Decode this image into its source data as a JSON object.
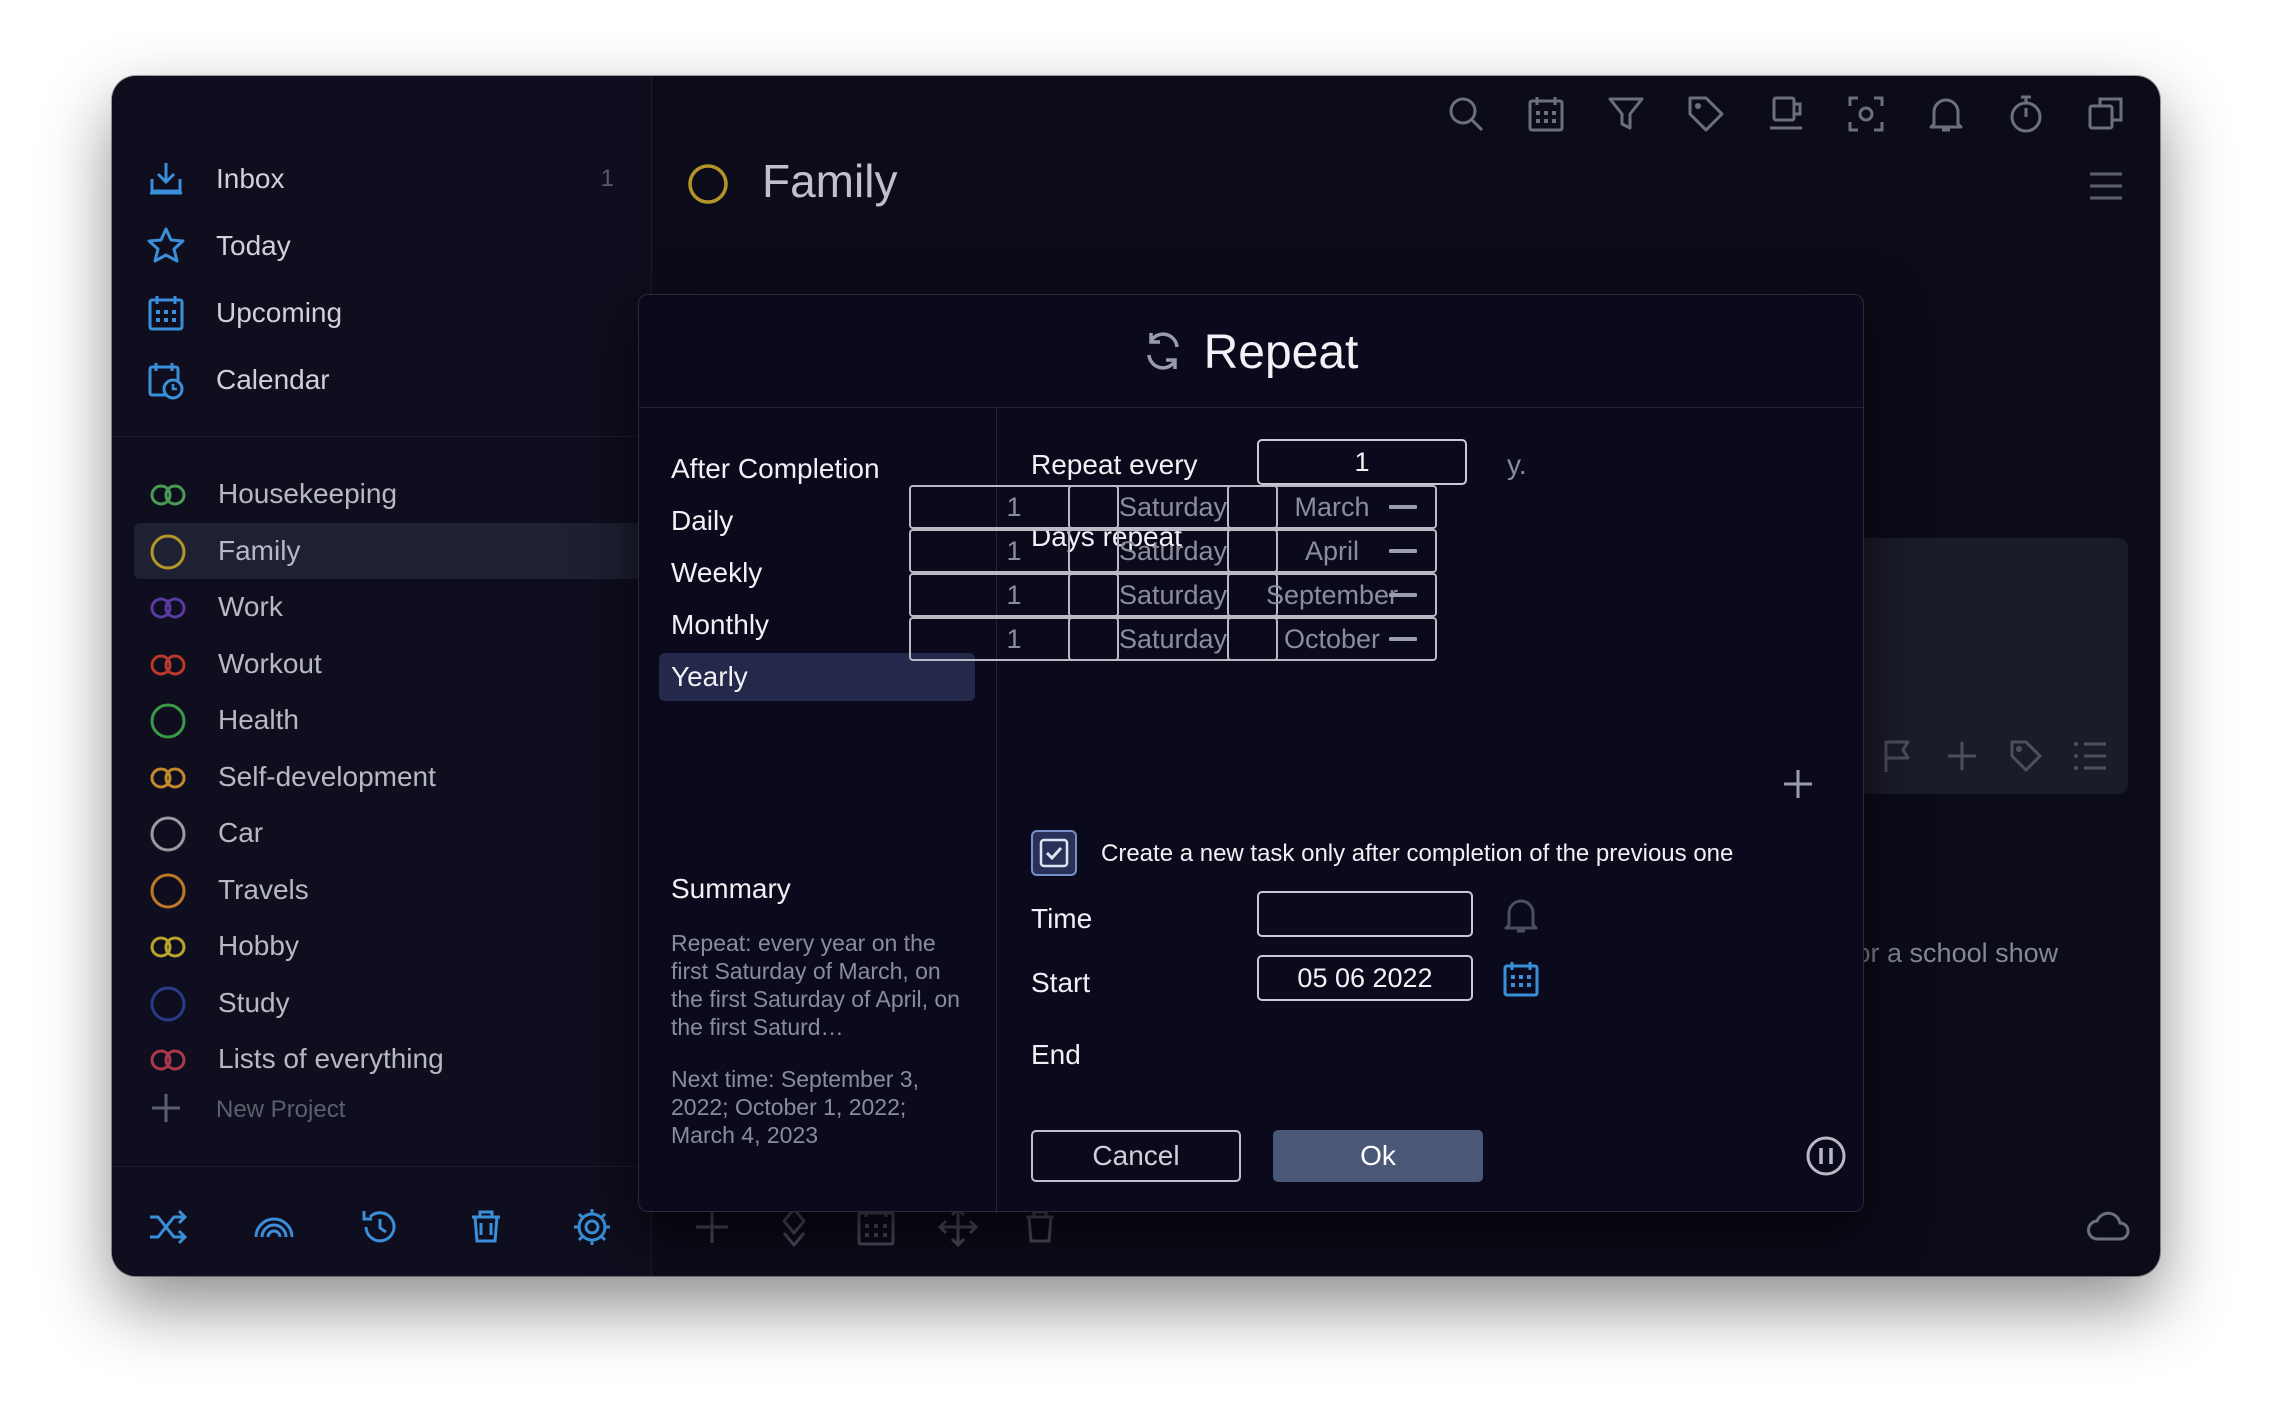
{
  "sidebar": {
    "nav": [
      {
        "label": "Inbox",
        "count": "1",
        "icon": "inbox-icon"
      },
      {
        "label": "Today",
        "icon": "star-icon"
      },
      {
        "label": "Upcoming",
        "icon": "calendar-grid-icon"
      },
      {
        "label": "Calendar",
        "icon": "calendar-clock-icon"
      }
    ],
    "projects": [
      {
        "label": "Housekeeping",
        "color": "#4a9a56",
        "icon": "double-ring-icon"
      },
      {
        "label": "Family",
        "color": "#b49628",
        "icon": "ring-icon"
      },
      {
        "label": "Work",
        "color": "#5a3aa0",
        "icon": "double-ring-icon"
      },
      {
        "label": "Workout",
        "color": "#b83a2a",
        "icon": "double-ring-icon"
      },
      {
        "label": "Health",
        "color": "#3a9a4a",
        "icon": "ring-icon"
      },
      {
        "label": "Self-development",
        "color": "#c28a2a",
        "icon": "double-ring-icon"
      },
      {
        "label": "Car",
        "color": "#9a9aa2",
        "icon": "ring-icon"
      },
      {
        "label": "Travels",
        "color": "#c07828",
        "icon": "ring-icon"
      },
      {
        "label": "Hobby",
        "color": "#b8a42a",
        "icon": "double-ring-icon"
      },
      {
        "label": "Study",
        "color": "#2a3a8a",
        "icon": "ring-icon"
      },
      {
        "label": "Lists of everything",
        "color": "#a8384a",
        "icon": "double-ring-icon"
      }
    ],
    "new_project": "New Project"
  },
  "main": {
    "title": "Family",
    "title_color": "#b49628",
    "background_task": "e Tracy for a school show"
  },
  "dialog": {
    "title": "Repeat",
    "modes": [
      "After Completion",
      "Daily",
      "Weekly",
      "Monthly",
      "Yearly"
    ],
    "active_mode": "Yearly",
    "repeat_every_label": "Repeat every",
    "repeat_every_value": "1",
    "repeat_every_unit": "y.",
    "days_repeat_label": "Days repeat",
    "rules": [
      {
        "num": "1",
        "day": "Saturday",
        "month": "March"
      },
      {
        "num": "1",
        "day": "Saturday",
        "month": "April"
      },
      {
        "num": "1",
        "day": "Saturday",
        "month": "September"
      },
      {
        "num": "1",
        "day": "Saturday",
        "month": "October"
      }
    ],
    "checkbox_label": "Create a new task only after completion of the previous one",
    "checkbox_checked": true,
    "time_label": "Time",
    "time_value": "",
    "start_label": "Start",
    "start_value": "05 06 2022",
    "end_label": "End",
    "summary_title": "Summary",
    "summary_text": "Repeat: every year on the first Saturday of March, on the first Saturday of April, on the first Saturd…",
    "next_time": "Next time: September 3, 2022; October 1, 2022; March 4, 2023",
    "cancel_label": "Cancel",
    "ok_label": "Ok"
  },
  "colors": {
    "accent_blue": "#3a8fd8",
    "window_bg": "#0c0b1a"
  }
}
